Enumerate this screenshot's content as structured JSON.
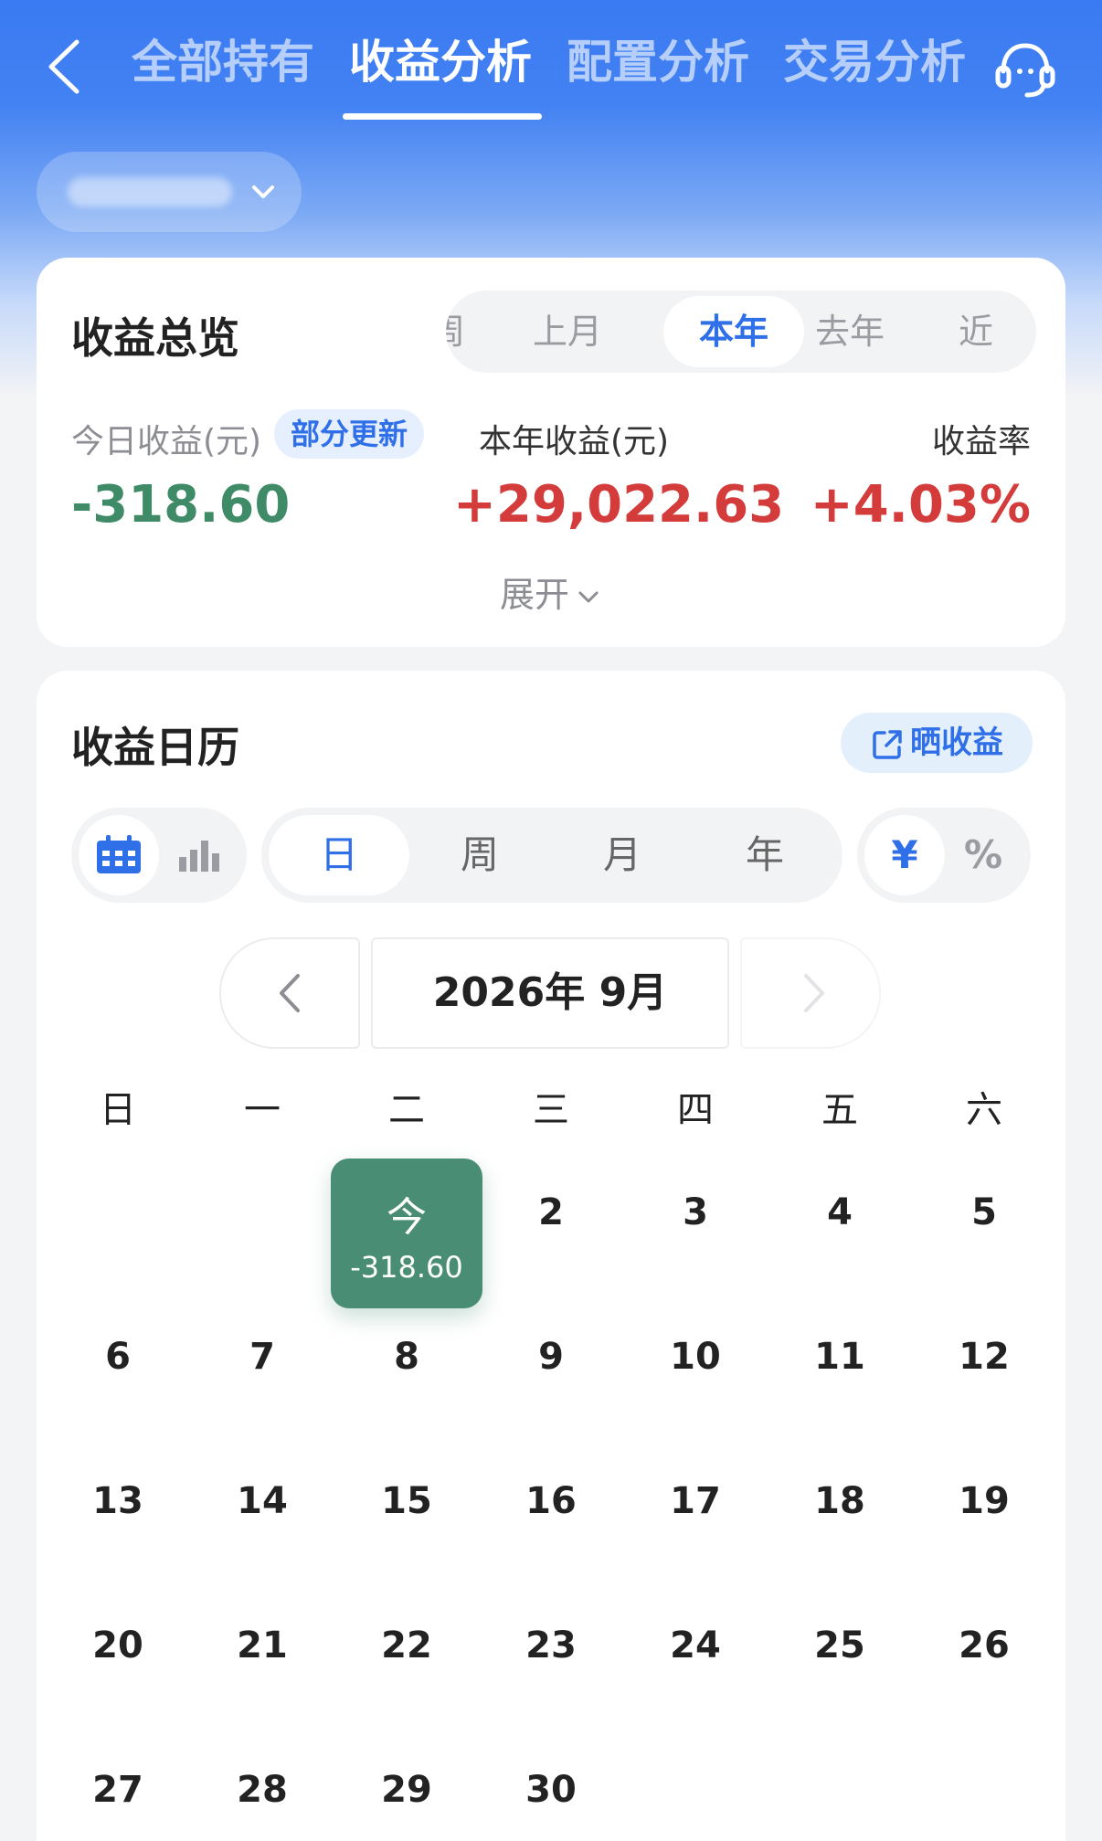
{
  "nav": {
    "tabs": [
      {
        "label": "全部持有",
        "active": false
      },
      {
        "label": "收益分析",
        "active": true
      },
      {
        "label": "配置分析",
        "active": false
      },
      {
        "label": "交易分析",
        "active": false
      }
    ],
    "back_icon": "chevron-left-icon",
    "service_icon": "headset-icon"
  },
  "account": {
    "chevron_icon": "chevron-down-icon"
  },
  "overview": {
    "title": "收益总览",
    "periods": [
      "周",
      "上月",
      "本年",
      "去年",
      "近"
    ],
    "active_period": "本年",
    "today_label": "今日收益(元)",
    "badge": "部分更新",
    "today_value": "-318.60",
    "year_label": "本年收益(元)",
    "year_value": "+29,022.63",
    "rate_label": "收益率",
    "rate_value": "+4.03%",
    "expand_label": "展开"
  },
  "calendar": {
    "title": "收益日历",
    "share_label": "晒收益",
    "view_icons": [
      "calendar-icon",
      "bar-chart-icon"
    ],
    "granularity": [
      "日",
      "周",
      "月",
      "年"
    ],
    "active_granularity": "日",
    "units": [
      "¥",
      "%"
    ],
    "active_unit": "¥",
    "month_label": "2026年 9月",
    "weekdays": [
      "日",
      "一",
      "二",
      "三",
      "四",
      "五",
      "六"
    ],
    "today_label": "今",
    "today_value": "-318.60",
    "days": [
      "2",
      "3",
      "4",
      "5",
      "6",
      "7",
      "8",
      "9",
      "10",
      "11",
      "12",
      "13",
      "14",
      "15",
      "16",
      "17",
      "18",
      "19",
      "20",
      "21",
      "22",
      "23",
      "24",
      "25",
      "26",
      "27",
      "28",
      "29",
      "30"
    ]
  },
  "colors": {
    "brand_blue": "#3a7af2",
    "accent_blue": "#2f6fe8",
    "loss_green": "#3f8a67",
    "gain_red": "#d43c3c",
    "today_cell": "#498e74"
  }
}
